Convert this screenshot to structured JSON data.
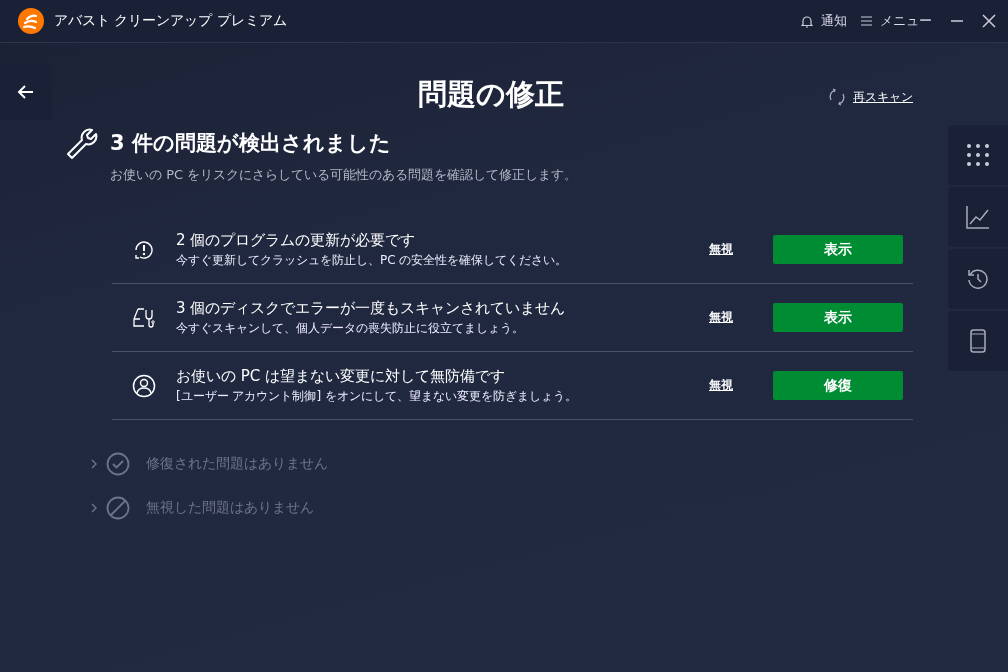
{
  "window": {
    "title": "アバスト クリーンアップ プレミアム",
    "actions": [
      "通知",
      "メニュー"
    ]
  },
  "page": {
    "title": "問題の修正",
    "rescan": "再スキャン"
  },
  "summary": {
    "heading": "3 件の問題が検出されました",
    "description": "お使いの PC をリスクにさらしている可能性のある問題を確認して修正します。"
  },
  "issues": [
    {
      "kind": "update",
      "title": "2 個のプログラムの更新が必要です",
      "description": "今すぐ更新してクラッシュを防止し、PC の安全性を確保してください。",
      "ignore": "無視",
      "action": "表示"
    },
    {
      "kind": "disk",
      "title": "3 個のディスクでエラーが一度もスキャンされていません",
      "description": "今すぐスキャンして、個人データの喪失防止に役立てましょう。",
      "ignore": "無視",
      "action": "表示"
    },
    {
      "kind": "account",
      "title": "お使いの PC は望まない変更に対して無防備です",
      "description": "[ユーザー アカウント制御] をオンにして、望まない変更を防ぎましょう。",
      "ignore": "無視",
      "action": "修復"
    }
  ],
  "sections": [
    {
      "kind": "fixed",
      "label": "修復された問題はありません",
      "expanded": false
    },
    {
      "kind": "ignored",
      "label": "無視した問題はありません",
      "expanded": false
    }
  ]
}
